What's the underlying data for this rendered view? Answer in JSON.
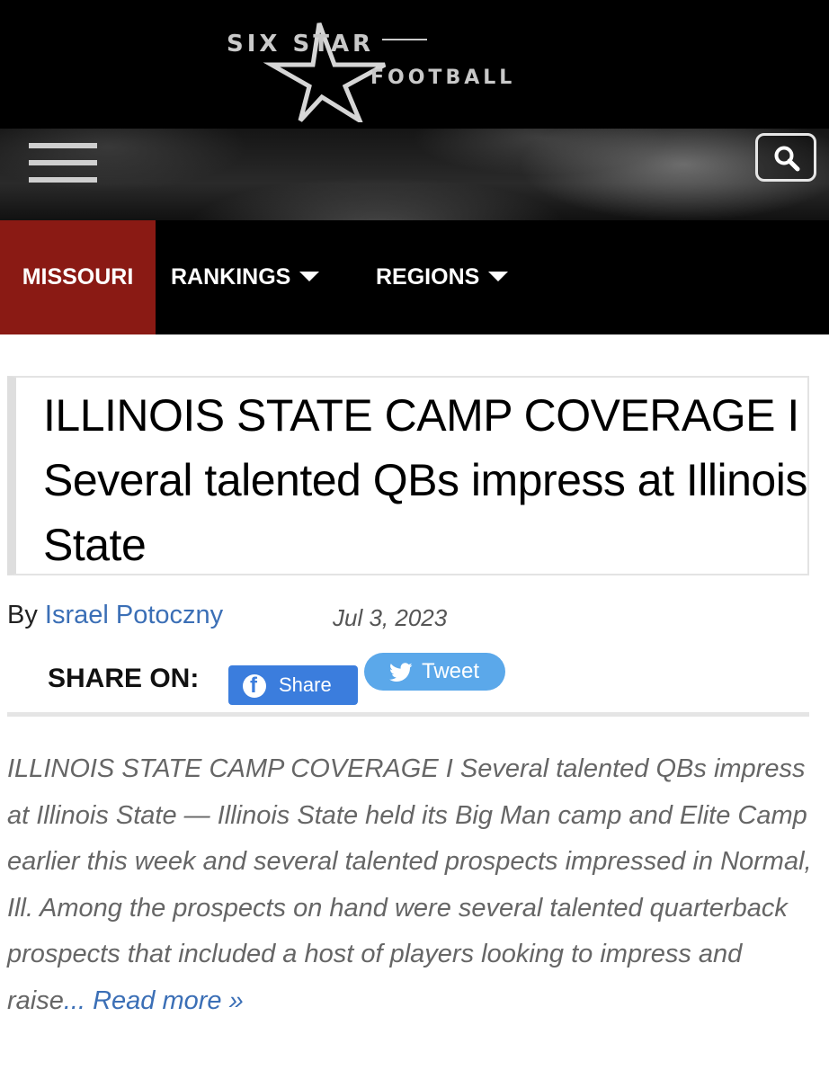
{
  "header": {
    "logo": {
      "line1": "SIX STAR",
      "line2": "FOOTBALL"
    },
    "menu_icon": "hamburger-menu-icon",
    "search_icon": "search-icon"
  },
  "nav": {
    "items": [
      {
        "label": "MISSOURI",
        "active": true
      },
      {
        "label": "RANKINGS",
        "dropdown": true
      },
      {
        "label": "REGIONS",
        "dropdown": true
      }
    ],
    "active_color": "#8a1a14"
  },
  "article": {
    "title": "ILLINOIS STATE CAMP COVERAGE I Several talented QBs impress at Illinois State",
    "byline_prefix": "By",
    "author": "Israel Potoczny",
    "date": "Jul 3, 2023",
    "share": {
      "label": "SHARE ON:",
      "facebook_label": "Share",
      "twitter_label": "Tweet"
    },
    "excerpt": "ILLINOIS STATE CAMP COVERAGE I Several talented QBs impress at Illinois State — Illinois State held its Big Man camp and Elite Camp earlier this week and several talented prospects impressed in Normal, Ill. Among the prospects on hand were several talented quarterback prospects that included a host of players looking to impress and raise",
    "read_more": "... Read more »"
  },
  "colors": {
    "facebook": "#3b7ddd",
    "twitter": "#5ba8ea",
    "link": "#3b6fb6"
  }
}
